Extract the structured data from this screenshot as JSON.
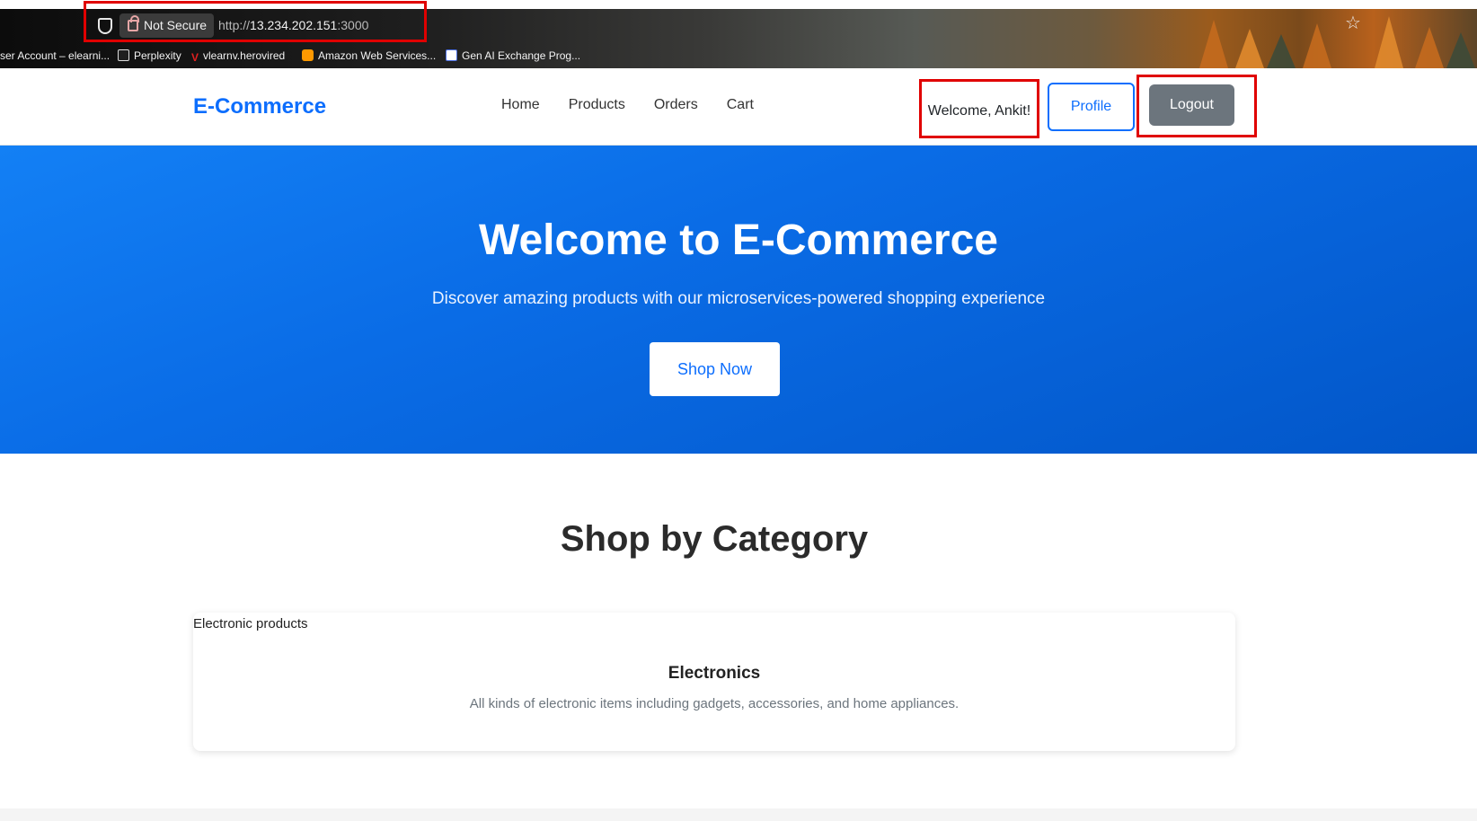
{
  "browser": {
    "security_label": "Not Secure",
    "url_scheme": "http://",
    "url_host": "13.234.202.151",
    "url_port": ":3000",
    "bookmarks": [
      {
        "label": "ser Account – elearni...",
        "icon": "none"
      },
      {
        "label": "Perplexity",
        "icon": "perplexity-icon"
      },
      {
        "label": "vlearnv.herovired",
        "icon": "v-logo-icon"
      },
      {
        "label": "Amazon Web Services...",
        "icon": "aws-icon"
      },
      {
        "label": "Gen AI Exchange Prog...",
        "icon": "gen-ai-icon"
      }
    ]
  },
  "header": {
    "brand": "E-Commerce",
    "nav": [
      "Home",
      "Products",
      "Orders",
      "Cart"
    ],
    "welcome": "Welcome, Ankit!",
    "profile_label": "Profile",
    "logout_label": "Logout"
  },
  "hero": {
    "title": "Welcome to E-Commerce",
    "subtitle": "Discover amazing products with our microservices-powered shopping experience",
    "cta_label": "Shop Now"
  },
  "categories": {
    "title": "Shop by Category",
    "items": [
      {
        "image_alt": "Electronic products",
        "name": "Electronics",
        "description": "All kinds of electronic items including gadgets, accessories, and home appliances."
      }
    ]
  },
  "colors": {
    "primary": "#0d6efd",
    "secondary": "#6c757d",
    "highlight": "#e00000"
  }
}
